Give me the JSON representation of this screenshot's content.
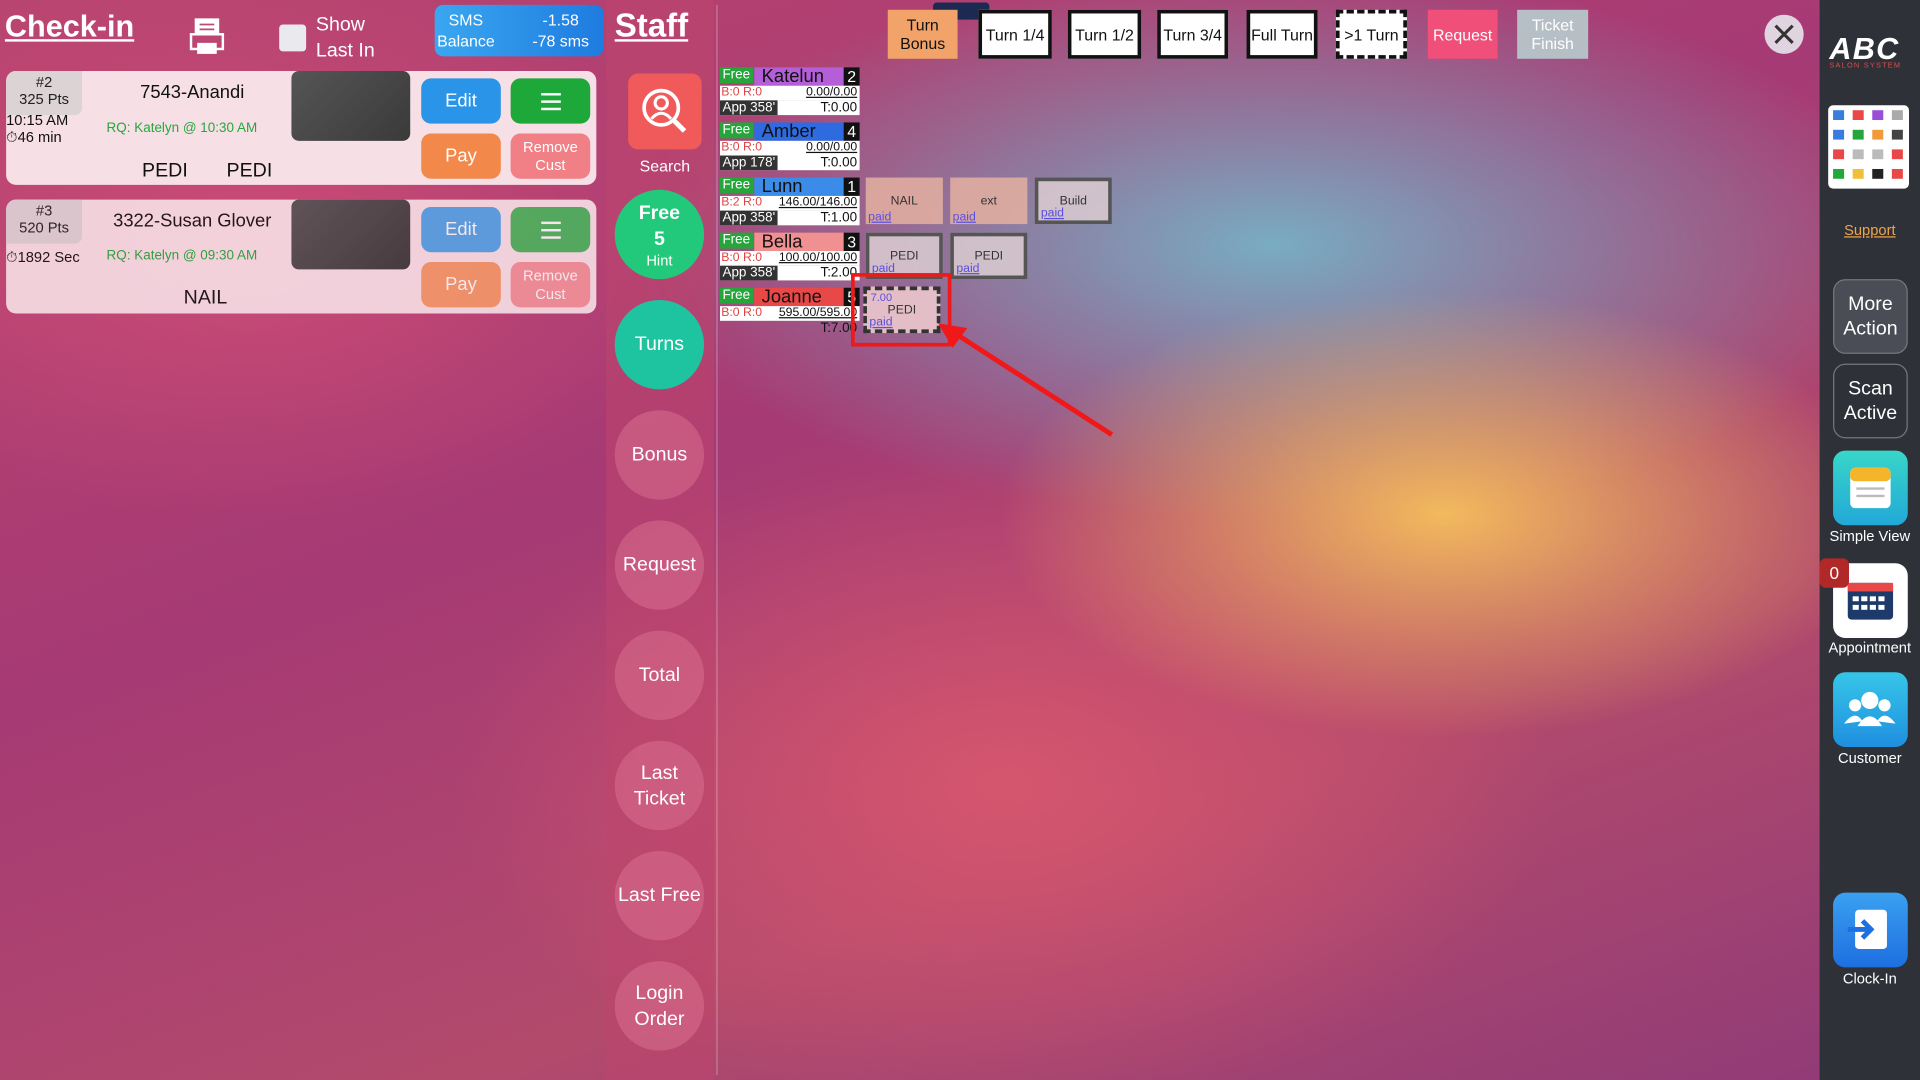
{
  "checkin": {
    "title": "Check-in",
    "show_last_in": "Show Last In",
    "sms": {
      "label_top": "SMS",
      "label_bottom": "Balance",
      "amount": "-1.58",
      "sms_count": "-78 sms"
    },
    "cards": [
      {
        "num": "#2",
        "pts": "325 Pts",
        "time": "10:15 AM",
        "wait": "⏱46 min",
        "name": "7543-Anandi",
        "rq": "RQ: Katelyn @ 10:30 AM",
        "services": [
          "PEDI",
          "PEDI"
        ]
      },
      {
        "num": "#3",
        "pts": "520 Pts",
        "time": "",
        "wait": "⏱1892 Sec",
        "name": "3322-Susan Glover",
        "rq": "RQ: Katelyn @ 09:30 AM",
        "services": [
          "NAIL"
        ]
      }
    ],
    "buttons": {
      "edit": "Edit",
      "pay": "Pay",
      "remove": "Remove Cust"
    }
  },
  "staff_col": {
    "title": "Staff",
    "search": "Search",
    "free": "Free",
    "free_count": "5",
    "hint": "Hint",
    "turns": "Turns",
    "bonus": "Bonus",
    "request": "Request",
    "total": "Total",
    "last_ticket": "Last Ticket",
    "last_free": "Last Free",
    "login_order": "Login Order"
  },
  "turn_buttons": [
    {
      "label": "Turn Bonus",
      "style": "orange"
    },
    {
      "label": "Turn 1/4",
      "style": "plain"
    },
    {
      "label": "Turn 1/2",
      "style": "plain"
    },
    {
      "label": "Turn 3/4",
      "style": "plain"
    },
    {
      "label": "Full Turn",
      "style": "plain"
    },
    {
      "label": ">1 Turn",
      "style": "dashed"
    },
    {
      "label": "Request",
      "style": "pink"
    },
    {
      "label": "Ticket Finish",
      "style": "gray"
    }
  ],
  "staff": [
    {
      "status": "Free",
      "name": "Katelun",
      "order": "2",
      "color": "#b45ed8",
      "br": "B:0 R:0",
      "amount": "0.00/0.00",
      "app": "App 358'",
      "turn": "T:0.00"
    },
    {
      "status": "Free",
      "name": "Amber",
      "order": "4",
      "color": "#2f6be0",
      "br": "B:0 R:0",
      "amount": "0.00/0.00",
      "app": "App 178'",
      "turn": "T:0.00"
    },
    {
      "status": "Free",
      "name": "Lunn",
      "order": "1",
      "color": "#3a8ce8",
      "br": "B:2 R:0",
      "amount": "146.00/146.00",
      "app": "App 358'",
      "turn": "T:1.00"
    },
    {
      "status": "Free",
      "name": "Bella",
      "order": "3",
      "color": "#f09090",
      "br": "B:0 R:0",
      "amount": "100.00/100.00",
      "app": "App 358'",
      "turn": "T:2.00"
    },
    {
      "status": "Free",
      "name": "Joanne",
      "order": "5",
      "color": "#e84848",
      "br": "B:0 R:0",
      "amount": "595.00/595.00",
      "app": "",
      "turn": "T:7.00"
    }
  ],
  "tiles": {
    "lunn": [
      {
        "label": "NAIL",
        "paid": "paid"
      },
      {
        "label": "ext",
        "paid": "paid"
      },
      {
        "label": "Build",
        "paid": "paid"
      }
    ],
    "bella": [
      {
        "label": "PEDI",
        "paid": "paid"
      },
      {
        "label": "PEDI",
        "paid": "paid"
      }
    ],
    "joanne": [
      {
        "label": "PEDI",
        "paid": "paid",
        "price": "7.00"
      }
    ]
  },
  "sidebar": {
    "logo": "ABC",
    "logo_sub": "SALON SYSTEM",
    "support": "Support",
    "more_action": "More Action",
    "scan_active": "Scan Active",
    "simple_view": "Simple View",
    "appointment": "Appointment",
    "appointment_badge": "0",
    "customer": "Customer",
    "clock_in": "Clock-In"
  },
  "colors": {
    "accent_green": "#22c97a",
    "accent_teal": "#1ec4a0",
    "highlight": "#f01818"
  }
}
